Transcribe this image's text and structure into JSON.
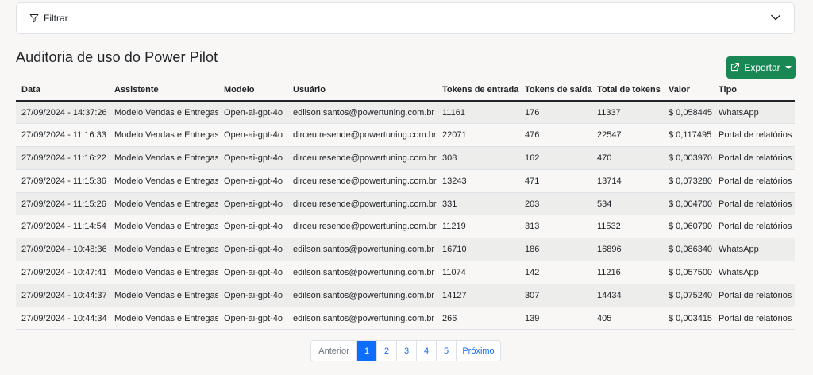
{
  "filter": {
    "label": "Filtrar"
  },
  "page": {
    "title": "Auditoria de uso do Power Pilot"
  },
  "export": {
    "label": "Exportar"
  },
  "table": {
    "columns": [
      "Data",
      "Assistente",
      "Modelo",
      "Usuário",
      "Tokens de entrada",
      "Tokens de saída",
      "Total de tokens",
      "Valor",
      "Tipo"
    ],
    "rows": [
      [
        "27/09/2024 - 14:37:26",
        "Modelo Vendas e Entregas",
        "Open-ai-gpt-4o",
        "edilson.santos@powertuning.com.br",
        "11161",
        "176",
        "11337",
        "$ 0,058445",
        "WhatsApp"
      ],
      [
        "27/09/2024 - 11:16:33",
        "Modelo Vendas e Entregas",
        "Open-ai-gpt-4o",
        "dirceu.resende@powertuning.com.br",
        "22071",
        "476",
        "22547",
        "$ 0,117495",
        "Portal de relatórios"
      ],
      [
        "27/09/2024 - 11:16:22",
        "Modelo Vendas e Entregas",
        "Open-ai-gpt-4o",
        "dirceu.resende@powertuning.com.br",
        "308",
        "162",
        "470",
        "$ 0,003970",
        "Portal de relatórios"
      ],
      [
        "27/09/2024 - 11:15:36",
        "Modelo Vendas e Entregas",
        "Open-ai-gpt-4o",
        "dirceu.resende@powertuning.com.br",
        "13243",
        "471",
        "13714",
        "$ 0,073280",
        "Portal de relatórios"
      ],
      [
        "27/09/2024 - 11:15:26",
        "Modelo Vendas e Entregas",
        "Open-ai-gpt-4o",
        "dirceu.resende@powertuning.com.br",
        "331",
        "203",
        "534",
        "$ 0,004700",
        "Portal de relatórios"
      ],
      [
        "27/09/2024 - 11:14:54",
        "Modelo Vendas e Entregas",
        "Open-ai-gpt-4o",
        "dirceu.resende@powertuning.com.br",
        "11219",
        "313",
        "11532",
        "$ 0,060790",
        "Portal de relatórios"
      ],
      [
        "27/09/2024 - 10:48:36",
        "Modelo Vendas e Entregas",
        "Open-ai-gpt-4o",
        "edilson.santos@powertuning.com.br",
        "16710",
        "186",
        "16896",
        "$ 0,086340",
        "WhatsApp"
      ],
      [
        "27/09/2024 - 10:47:41",
        "Modelo Vendas e Entregas",
        "Open-ai-gpt-4o",
        "edilson.santos@powertuning.com.br",
        "11074",
        "142",
        "11216",
        "$ 0,057500",
        "WhatsApp"
      ],
      [
        "27/09/2024 - 10:44:37",
        "Modelo Vendas e Entregas",
        "Open-ai-gpt-4o",
        "edilson.santos@powertuning.com.br",
        "14127",
        "307",
        "14434",
        "$ 0,075240",
        "Portal de relatórios"
      ],
      [
        "27/09/2024 - 10:44:34",
        "Modelo Vendas e Entregas",
        "Open-ai-gpt-4o",
        "edilson.santos@powertuning.com.br",
        "266",
        "139",
        "405",
        "$ 0,003415",
        "Portal de relatórios"
      ]
    ]
  },
  "pagination": {
    "previous": "Anterior",
    "pages": [
      "1",
      "2",
      "3",
      "4",
      "5"
    ],
    "active_page": "1",
    "next": "Próximo"
  },
  "colors": {
    "accent": "#0d6efd",
    "export_button": "#198754",
    "row_striped": "#ededec",
    "background": "#f8f7f5"
  },
  "icons": {
    "filter": "filter-icon",
    "expand": "chevron-down-icon",
    "export": "external-link-icon"
  }
}
